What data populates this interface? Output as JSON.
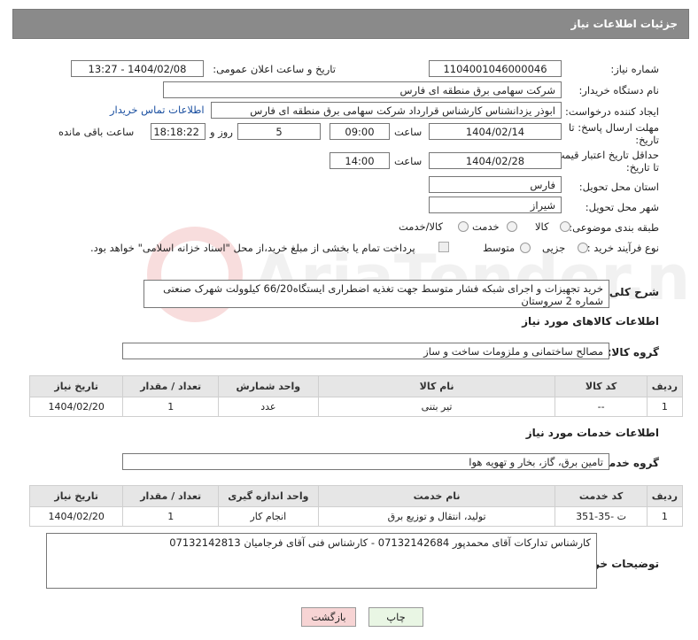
{
  "header": {
    "title": "جزئیات اطلاعات نیاز"
  },
  "fields": {
    "need_number_label": "شماره نیاز:",
    "need_number": "1104001046000046",
    "announce_label": "تاریخ و ساعت اعلان عمومی:",
    "announce_value": "1404/02/08 - 13:27",
    "buyer_org_label": "نام دستگاه خریدار:",
    "buyer_org": "شرکت سهامی برق منطقه ای فارس",
    "creator_label": "ایجاد کننده درخواست:",
    "creator": "ابوذر  یزدانشناس کارشناس قرارداد شرکت سهامی برق منطقه ای فارس",
    "contact_link": "اطلاعات تماس خریدار",
    "reply_deadline_label": "مهلت ارسال پاسخ: تا تاریخ:",
    "reply_date": "1404/02/14",
    "time_label": "ساعت",
    "reply_time": "09:00",
    "days_value": "5",
    "days_label": "روز و",
    "remaining_value": "18:18:22",
    "remaining_label": "ساعت باقی مانده",
    "validity_label": "حداقل تاریخ اعتبار قیمت: تا تاریخ:",
    "validity_date": "1404/02/28",
    "validity_time": "14:00",
    "province_label": "استان محل تحویل:",
    "province": "فارس",
    "city_label": "شهر محل تحویل:",
    "city": "شیراز",
    "category_label": "طبقه بندی موضوعی:",
    "category_options": [
      "کالا",
      "خدمت",
      "کالا/خدمت"
    ],
    "process_label": "نوع فرآیند خرید :",
    "process_options": [
      "جزیی",
      "متوسط"
    ],
    "payment_note": "پرداخت تمام یا بخشی از مبلغ خرید،از محل \"اسناد خزانه اسلامی\" خواهد بود."
  },
  "description": {
    "label": "شرح کلی نیاز:",
    "text": "خرید تجهیزات و اجرای  شبکه  فشار متوسط جهت تغذیه اضطراری  ایستگاه66/20 کیلوولت شهرک صنعتی شماره 2 سروستان"
  },
  "goods": {
    "section_title": "اطلاعات کالاهای مورد نیاز",
    "group_label": "گروه کالا:",
    "group_value": "مصالح ساختمانی و ملزومات ساخت و ساز",
    "columns": [
      "ردیف",
      "کد کالا",
      "نام کالا",
      "واحد شمارش",
      "تعداد / مقدار",
      "تاریخ نیاز"
    ],
    "rows": [
      [
        "1",
        "--",
        "تیر بتنی",
        "عدد",
        "1",
        "1404/02/20"
      ]
    ]
  },
  "services": {
    "section_title": "اطلاعات خدمات مورد نیاز",
    "group_label": "گروه خدمت:",
    "group_value": "تامین برق، گاز، بخار و تهویه هوا",
    "columns": [
      "ردیف",
      "کد خدمت",
      "نام خدمت",
      "واحد اندازه گیری",
      "تعداد / مقدار",
      "تاریخ نیاز"
    ],
    "rows": [
      [
        "1",
        "ت -35-351",
        "تولید، انتقال و توزیع برق",
        "انجام کار",
        "1",
        "1404/02/20"
      ]
    ]
  },
  "buyer_notes": {
    "label": "توضیحات خریدار:",
    "text": "کارشناس تدارکات آقای محمدپور 07132142684 - کارشناس فنی آقای فرجامیان 07132142813"
  },
  "buttons": {
    "print": "چاپ",
    "back": "بازگشت"
  },
  "watermark": {
    "text": "AriaTender.neT"
  },
  "colors": {
    "header_bg": "#8a8a8a",
    "link": "#1a4fa0",
    "back_btn": "#f7d4d4",
    "print_btn": "#e9f6e4"
  }
}
